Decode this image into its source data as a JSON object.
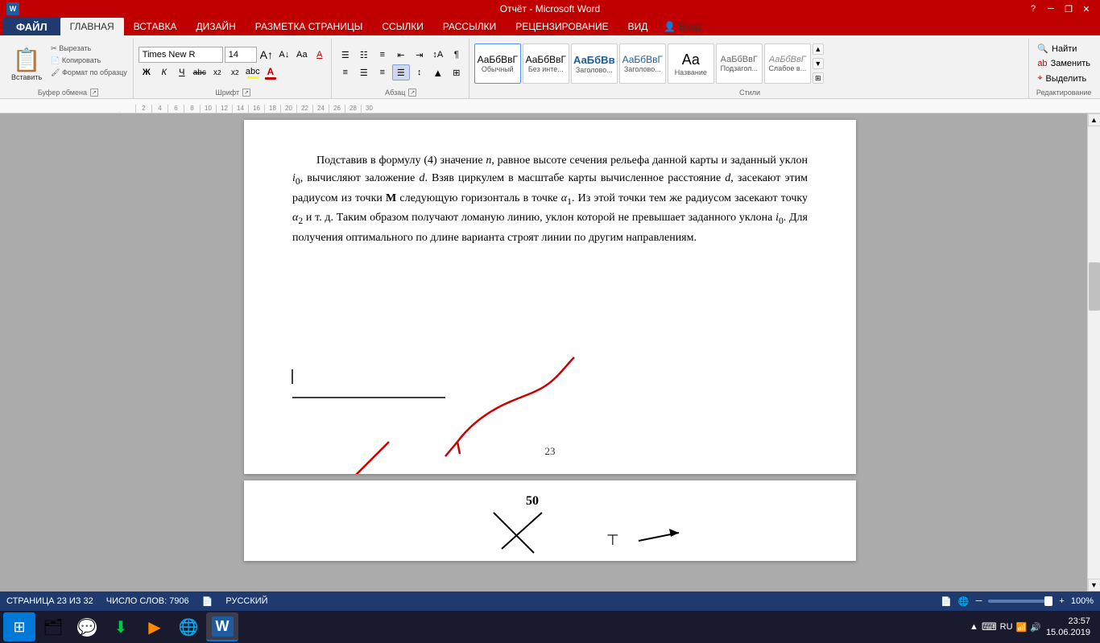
{
  "titleBar": {
    "title": "Отчёт - Microsoft Word",
    "helpIcon": "?",
    "minimizeLabel": "─",
    "restoreLabel": "❐",
    "closeLabel": "✕"
  },
  "menuBar": {
    "file": "ФАЙЛ",
    "items": [
      "ГЛАВНАЯ",
      "ВСТАВКА",
      "ДИЗАЙН",
      "РАЗМЕТКА СТРАНИЦЫ",
      "ССЫЛКИ",
      "РАССЫЛКИ",
      "РЕЦЕНЗИРОВАНИЕ",
      "ВИД"
    ]
  },
  "ribbon": {
    "clipboard": {
      "label": "Буфер обмена",
      "paste": "Вставить",
      "cut": "Вырезать",
      "copy": "Копировать",
      "formatPainter": "Формат по образцу"
    },
    "font": {
      "label": "Шрифт",
      "fontName": "Times New R",
      "fontSize": "14",
      "growBtn": "A",
      "shrinkBtn": "A",
      "caseBtn": "Аа",
      "clearBtn": "A",
      "bold": "Ж",
      "italic": "К",
      "underline": "Ч",
      "strikethrough": "abc",
      "subscript": "x₂",
      "superscript": "x²",
      "fontColor": "А",
      "highlight": "abc"
    },
    "paragraph": {
      "label": "Абзац"
    },
    "styles": {
      "label": "Стили",
      "items": [
        {
          "name": "Обычный",
          "preview": "АаБбВвГ"
        },
        {
          "name": "Без инте...",
          "preview": "АаБбВвГ"
        },
        {
          "name": "Заголово...",
          "preview": "АаБбВв"
        },
        {
          "name": "Заголово...",
          "preview": "АаБбВвГ"
        },
        {
          "name": "Название",
          "preview": "Аа"
        },
        {
          "name": "Подзагол...",
          "preview": "АаБбВвГ"
        },
        {
          "name": "Слабое в...",
          "preview": "АаБбВвГ"
        }
      ]
    },
    "editing": {
      "label": "Редактирование",
      "find": "Найти",
      "replace": "Заменить",
      "select": "Выделить"
    },
    "login": "Вход"
  },
  "document": {
    "page1": {
      "text": "Подставив в формулу (4) значение n, равное высоте сечения рельефа данной карты и заданный уклон i₀, вычисляют заложение d. Взяв циркулем в масштабе карты вычисленное расстояние d, засекают этим радиусом из точки M следующую горизонталь в точке α₁. Из этой точки тем же радиусом засекают точку α₂ и т. д. Таким образом получают ломаную линию, уклон которой не превышает заданного уклона i₀. Для получения оптимального по длине варианта строят линии по другим направлениям.",
      "pageNumber": "23"
    }
  },
  "statusBar": {
    "page": "СТРАНИЦА 23 ИЗ 32",
    "wordCount": "ЧИСЛО СЛОВ: 7906",
    "language": "РУССКИЙ",
    "zoom": "100%",
    "zoomMinus": "─",
    "zoomPlus": "+"
  },
  "taskbar": {
    "startIcon": "⊞",
    "apps": [
      {
        "icon": "🗂",
        "name": "explorer"
      },
      {
        "icon": "💬",
        "name": "discord"
      },
      {
        "icon": "⬇",
        "name": "downloader"
      },
      {
        "icon": "▶",
        "name": "player"
      },
      {
        "icon": "🌐",
        "name": "chrome"
      },
      {
        "icon": "W",
        "name": "word"
      }
    ],
    "sysArea": {
      "language": "RU",
      "time": "23:57",
      "date": "15.06.2019"
    }
  }
}
